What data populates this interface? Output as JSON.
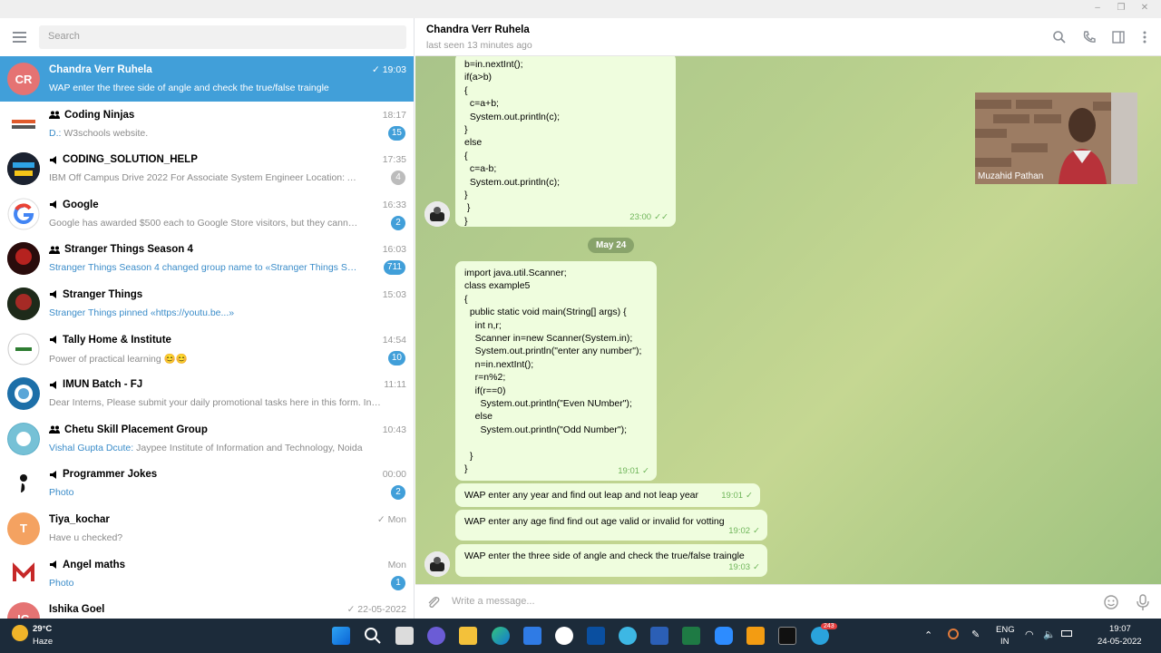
{
  "sidebar": {
    "search_placeholder": "Search",
    "chats": [
      {
        "name": "Chandra Verr Ruhela",
        "initials": "CR",
        "time": "19:03",
        "preview": "WAP enter the three side of angle and check the true/false traingle",
        "read": true,
        "active": true,
        "icon": "none"
      },
      {
        "name": "Coding Ninjas",
        "time": "18:17",
        "sender": "D.:",
        "preview": "W3schools website.",
        "badge": "15",
        "icon": "group-icon"
      },
      {
        "name": "CODING_SOLUTION_HELP",
        "time": "17:35",
        "preview": "IBM Off Campus Drive 2022 For Associate System Engineer  Location: Across I...",
        "badge": "4",
        "badge_gray": true,
        "icon": "megaphone-icon"
      },
      {
        "name": "Google",
        "time": "16:33",
        "preview": "Google has awarded $500 each to Google Store visitors, but they cannot u...",
        "badge": "2",
        "icon": "megaphone-icon"
      },
      {
        "name": "Stranger Things Season 4",
        "time": "16:03",
        "preview": "Stranger Things Season 4 changed group name to «Stranger Things Season ...",
        "badge": "711",
        "preview_blue": true,
        "icon": "group-icon"
      },
      {
        "name": "Stranger Things",
        "time": "15:03",
        "preview": "Stranger Things pinned «https://youtu.be...»",
        "preview_blue": true,
        "icon": "megaphone-icon"
      },
      {
        "name": "Tally Home & Institute",
        "time": "14:54",
        "preview": "Power of practical learning 😊😊",
        "badge": "10",
        "icon": "megaphone-icon"
      },
      {
        "name": "IMUN Batch - FJ",
        "time": "11:11",
        "preview": "Dear Interns,  Please submit your daily promotional tasks here in this form. Intern...",
        "icon": "megaphone-icon"
      },
      {
        "name": "Chetu Skill Placement Group",
        "time": "10:43",
        "sender": "Vishal Gupta Dcute:",
        "preview": "Jaypee Institute of Information and Technology, Noida",
        "icon": "group-icon"
      },
      {
        "name": "Programmer Jokes",
        "time": "00:00",
        "preview": "Photo",
        "badge": "2",
        "preview_blue": true,
        "icon": "megaphone-icon"
      },
      {
        "name": "Tiya_kochar",
        "initials": "T",
        "time": "Mon",
        "preview": "Have u checked?",
        "read": true,
        "icon": "none"
      },
      {
        "name": "Angel maths",
        "time": "Mon",
        "preview": "Photo",
        "badge": "1",
        "preview_blue": true,
        "icon": "megaphone-icon"
      },
      {
        "name": "Ishika Goel",
        "initials": "IG",
        "time": "22-05-2022",
        "preview": "",
        "read": true,
        "icon": "none"
      }
    ]
  },
  "header": {
    "title": "Chandra Verr Ruhela",
    "status": "last seen 13 minutes ago"
  },
  "messages": {
    "code1": "b=in.nextInt();\nif(a>b)\n{\n  c=a+b;\n  System.out.println(c);\n}\nelse\n{\n  c=a-b;\n  System.out.println(c);\n}\n }\n}",
    "code1_time": "23:00",
    "date_chip": "May 24",
    "code2": "import java.util.Scanner;\nclass example5\n{\n  public static void main(String[] args) {\n    int n,r;\n    Scanner in=new Scanner(System.in);\n    System.out.println(\"enter any number\");\n    n=in.nextInt();\n    r=n%2;\n    if(r==0)\n      System.out.println(\"Even NUmber\");\n    else\n      System.out.println(\"Odd Number\");\n\n  }\n}",
    "code2_time": "19:01",
    "msg3": "WAP enter any year and find out leap and not leap year",
    "msg3_time": "19:01",
    "msg4": "WAP enter any age find find out age valid or invalid for votting",
    "msg4_time": "19:02",
    "msg5": "WAP enter the three side of angle and check the true/false traingle",
    "msg5_time": "19:03"
  },
  "video": {
    "name": "Muzahid Pathan"
  },
  "composer": {
    "placeholder": "Write a message..."
  },
  "taskbar": {
    "weather_temp": "29°C",
    "weather_desc": "Haze",
    "lang1": "ENG",
    "lang2": "IN",
    "clock_time": "19:07",
    "clock_date": "24-05-2022",
    "telegram_badge": "243"
  },
  "colors": {
    "accent": "#419fd9",
    "bubble": "#effdde",
    "check": "#6fb55a"
  }
}
